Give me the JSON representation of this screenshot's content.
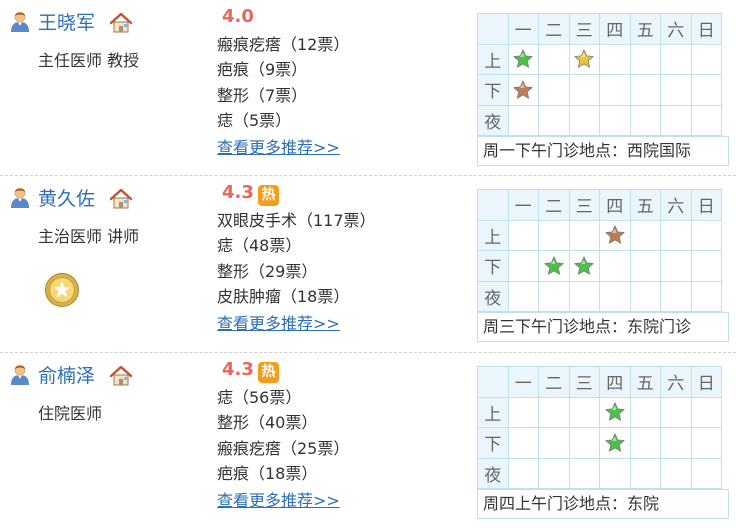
{
  "weekday_headers": [
    "一",
    "二",
    "三",
    "四",
    "五",
    "六",
    "日"
  ],
  "period_labels": [
    "上",
    "下",
    "夜"
  ],
  "more_link_label": "查看更多推荐>>",
  "colors": {
    "star_green": "#49c24a",
    "star_yellow": "#e6c83a",
    "star_brown": "#c27a55",
    "score": "#e8665a",
    "hot_badge": "#f59c1a"
  },
  "doctors": [
    {
      "name": "王晓军",
      "title": "主任医师 教授",
      "score": "4.0",
      "hot": "",
      "has_medal": false,
      "votes": [
        "瘢痕疙瘩（12票）",
        "疤痕（9票）",
        "整形（7票）",
        "痣（5票）"
      ],
      "schedule": [
        [
          "green",
          "",
          "yellow",
          "",
          "",
          "",
          ""
        ],
        [
          "brown",
          "",
          "",
          "",
          "",
          "",
          ""
        ],
        [
          "",
          "",
          "",
          "",
          "",
          "",
          ""
        ]
      ],
      "location": "周一下午门诊地点：西院国际"
    },
    {
      "name": "黄久佐",
      "title": "主治医师 讲师",
      "score": "4.3",
      "hot": "热",
      "has_medal": true,
      "votes": [
        "双眼皮手术（117票）",
        "痣（48票）",
        "整形（29票）",
        "皮肤肿瘤（18票）"
      ],
      "schedule": [
        [
          "",
          "",
          "",
          "brown",
          "",
          "",
          ""
        ],
        [
          "",
          "green",
          "green",
          "",
          "",
          "",
          ""
        ],
        [
          "",
          "",
          "",
          "",
          "",
          "",
          ""
        ]
      ],
      "location": "周三下午门诊地点：东院门诊"
    },
    {
      "name": "俞楠泽",
      "title": "住院医师",
      "score": "4.3",
      "hot": "热",
      "has_medal": false,
      "votes": [
        "痣（56票）",
        "整形（40票）",
        "瘢痕疙瘩（25票）",
        "疤痕（18票）"
      ],
      "schedule": [
        [
          "",
          "",
          "",
          "green",
          "",
          "",
          ""
        ],
        [
          "",
          "",
          "",
          "green",
          "",
          "",
          ""
        ],
        [
          "",
          "",
          "",
          "",
          "",
          "",
          ""
        ]
      ],
      "location": "周四上午门诊地点：东院"
    }
  ]
}
